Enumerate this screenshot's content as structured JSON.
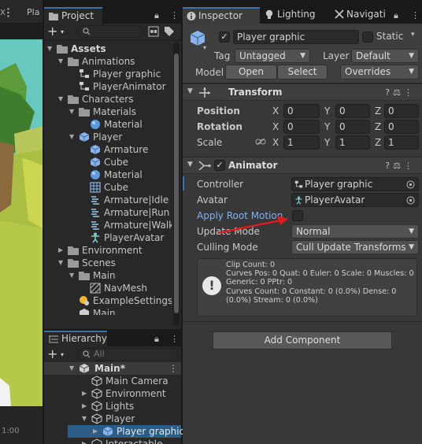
{
  "scene": {
    "tab_label": "Pla",
    "time": "1:00"
  },
  "project": {
    "tab": "Project",
    "badge": "24",
    "tree": [
      {
        "label": "Assets",
        "bold": true
      },
      {
        "label": "Animations"
      },
      {
        "label": "Player graphic"
      },
      {
        "label": "PlayerAnimator"
      },
      {
        "label": "Characters"
      },
      {
        "label": "Materials"
      },
      {
        "label": "Material"
      },
      {
        "label": "Player"
      },
      {
        "label": "Armature"
      },
      {
        "label": "Cube"
      },
      {
        "label": "Material"
      },
      {
        "label": "Cube"
      },
      {
        "label": "Armature|Idle"
      },
      {
        "label": "Armature|Run"
      },
      {
        "label": "Armature|Walk"
      },
      {
        "label": "PlayerAvatar"
      },
      {
        "label": "Environment"
      },
      {
        "label": "Scenes"
      },
      {
        "label": "Main"
      },
      {
        "label": "NavMesh"
      },
      {
        "label": "ExampleSettings"
      },
      {
        "label": "Main"
      }
    ]
  },
  "hierarchy": {
    "tab": "Hierarchy",
    "search_placeholder": "All",
    "tree": [
      {
        "label": "Main*"
      },
      {
        "label": "Main Camera"
      },
      {
        "label": "Environment"
      },
      {
        "label": "Lights"
      },
      {
        "label": "Player"
      },
      {
        "label": "Player graphic"
      },
      {
        "label": "Interactable"
      }
    ]
  },
  "inspector": {
    "tabs": [
      "Inspector",
      "Lighting",
      "Navigati"
    ],
    "object_name": "Player graphic",
    "static_label": "Static",
    "tag_label": "Tag",
    "tag_value": "Untagged",
    "layer_label": "Layer",
    "layer_value": "Default",
    "model_label": "Model",
    "open_label": "Open",
    "select_label": "Select",
    "overrides_label": "Overrides",
    "transform": {
      "title": "Transform",
      "position_label": "Position",
      "rotation_label": "Rotation",
      "scale_label": "Scale",
      "position": [
        "0",
        "0",
        "0"
      ],
      "rotation": [
        "0",
        "0",
        "0"
      ],
      "scale": [
        "1",
        "1",
        "1"
      ],
      "axes": [
        "X",
        "Y",
        "Z"
      ]
    },
    "animator": {
      "title": "Animator",
      "controller_label": "Controller",
      "controller_value": "Player graphic",
      "avatar_label": "Avatar",
      "avatar_value": "PlayerAvatar",
      "apply_root_motion_label": "Apply Root Motion",
      "apply_root_motion": false,
      "update_mode_label": "Update Mode",
      "update_mode_value": "Normal",
      "culling_mode_label": "Culling Mode",
      "culling_mode_value": "Cull Update Transforms",
      "info_lines": [
        "Clip Count: 0",
        "Curves Pos: 0 Quat: 0 Euler: 0 Scale: 0 Muscles: 0 Generic: 0 PPtr: 0",
        "Curves Count: 0 Constant: 0 (0.0%) Dense: 0 (0.0%) Stream: 0 (0.0%)"
      ]
    },
    "add_component_label": "Add Component"
  },
  "colors": {
    "accent": "#3a72b0",
    "highlight_label": "#7eb3f0",
    "arrow": "#e01b1b",
    "selection": "#2c5d87"
  }
}
